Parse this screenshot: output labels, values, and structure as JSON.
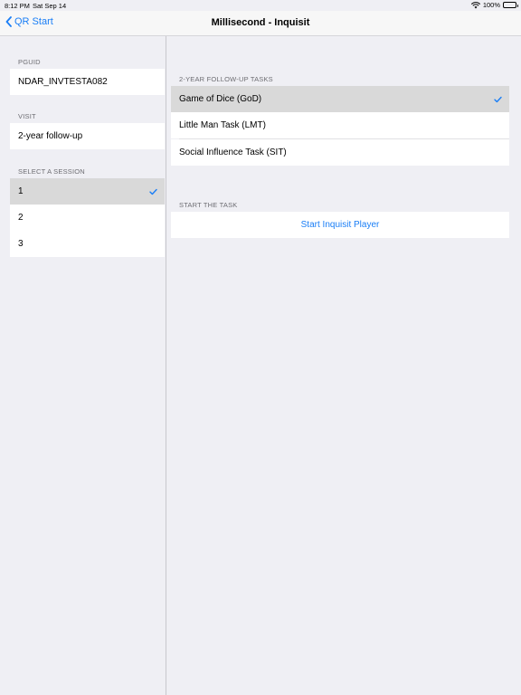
{
  "status_bar": {
    "time": "8:12 PM",
    "date": "Sat Sep 14",
    "battery": "100%"
  },
  "nav": {
    "back_label": "QR Start",
    "title": "Millisecond - Inquisit"
  },
  "master": {
    "pguid_header": "PGUID",
    "pguid_value": "NDAR_INVTESTA082",
    "visit_header": "VISIT",
    "visit_value": "2-year follow-up",
    "session_header": "SELECT A SESSION",
    "sessions": [
      "1",
      "2",
      "3"
    ],
    "selected_session": "1"
  },
  "detail": {
    "tasks_header": "2-YEAR FOLLOW-UP TASKS",
    "tasks": [
      "Game of Dice (GoD)",
      "Little Man Task (LMT)",
      "Social Influence Task (SIT)"
    ],
    "selected_task": "Game of Dice (GoD)",
    "start_header": "START THE TASK",
    "start_label": "Start Inquisit Player"
  },
  "colors": {
    "accent": "#1a7ef6",
    "background": "#efeff4",
    "selected_row": "#d9d9d9"
  }
}
